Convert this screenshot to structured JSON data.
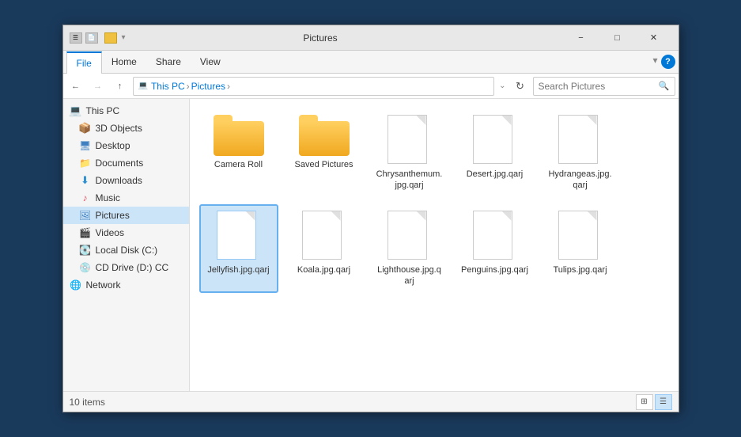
{
  "window": {
    "title": "Pictures",
    "title_bar_label": "Pictures"
  },
  "ribbon": {
    "tabs": [
      "File",
      "Home",
      "Share",
      "View"
    ],
    "active_tab": "File",
    "expand_icon": "▾",
    "help_label": "?"
  },
  "address_bar": {
    "back_icon": "←",
    "forward_icon": "→",
    "up_icon": "↑",
    "path_parts": [
      "This PC",
      "Pictures"
    ],
    "refresh_icon": "↻",
    "search_placeholder": "Search Pictures",
    "chevron_icon": "⌄"
  },
  "sidebar": {
    "items": [
      {
        "id": "this-pc",
        "label": "This PC",
        "icon": "💻",
        "level": 0
      },
      {
        "id": "3d-objects",
        "label": "3D Objects",
        "icon": "📦",
        "level": 1
      },
      {
        "id": "desktop",
        "label": "Desktop",
        "icon": "🖥",
        "level": 1
      },
      {
        "id": "documents",
        "label": "Documents",
        "icon": "📁",
        "level": 1
      },
      {
        "id": "downloads",
        "label": "Downloads",
        "icon": "⬇",
        "level": 1
      },
      {
        "id": "music",
        "label": "Music",
        "icon": "♪",
        "level": 1
      },
      {
        "id": "pictures",
        "label": "Pictures",
        "icon": "🖼",
        "level": 1,
        "active": true
      },
      {
        "id": "videos",
        "label": "Videos",
        "icon": "🎬",
        "level": 1
      },
      {
        "id": "local-disk",
        "label": "Local Disk (C:)",
        "icon": "💽",
        "level": 1
      },
      {
        "id": "cd-drive",
        "label": "CD Drive (D:) CC",
        "icon": "💿",
        "level": 1
      },
      {
        "id": "network",
        "label": "Network",
        "icon": "🌐",
        "level": 0
      }
    ]
  },
  "content": {
    "items": [
      {
        "id": "camera-roll",
        "label": "Camera Roll",
        "type": "folder",
        "selected": false
      },
      {
        "id": "saved-pictures",
        "label": "Saved Pictures",
        "type": "folder",
        "selected": false
      },
      {
        "id": "chrysanthemum",
        "label": "Chrysanthemum.\njpg.qarj",
        "type": "file",
        "selected": false
      },
      {
        "id": "desert",
        "label": "Desert.jpg.qarj",
        "type": "file",
        "selected": false
      },
      {
        "id": "hydrangeas",
        "label": "Hydrangeas.jpg.\nqarj",
        "type": "file",
        "selected": false
      },
      {
        "id": "jellyfish",
        "label": "Jellyfish.jpg.qarj",
        "type": "file",
        "selected": true
      },
      {
        "id": "koala",
        "label": "Koala.jpg.qarj",
        "type": "file",
        "selected": false
      },
      {
        "id": "lighthouse",
        "label": "Lighthouse.jpg.q\narj",
        "type": "file",
        "selected": false
      },
      {
        "id": "penguins",
        "label": "Penguins.jpg.qarj",
        "type": "file",
        "selected": false
      },
      {
        "id": "tulips",
        "label": "Tulips.jpg.qarj",
        "type": "file",
        "selected": false
      }
    ]
  },
  "status_bar": {
    "item_count": "10 items",
    "view_medium_icon": "⊞",
    "view_list_icon": "☰"
  }
}
